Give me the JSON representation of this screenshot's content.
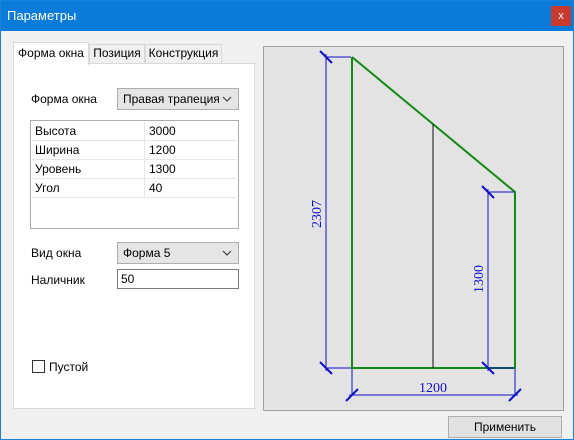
{
  "window": {
    "title": "Параметры",
    "close_label": "x"
  },
  "tabs": [
    {
      "label": "Форма окна",
      "active": true
    },
    {
      "label": "Позиция",
      "active": false
    },
    {
      "label": "Конструкция",
      "active": false
    }
  ],
  "form": {
    "shape_label": "Форма окна",
    "shape_value": "Правая трапеция",
    "params": [
      {
        "name": "Высота",
        "value": "3000"
      },
      {
        "name": "Ширина",
        "value": "1200"
      },
      {
        "name": "Уровень",
        "value": "1300"
      },
      {
        "name": "Угол",
        "value": "40"
      }
    ],
    "view_label": "Вид окна",
    "view_value": "Форма 5",
    "trim_label": "Наличник",
    "trim_value": "50",
    "empty_label": "Пустой",
    "empty_checked": false
  },
  "preview": {
    "dim_height": "2307",
    "dim_level": "1300",
    "dim_width": "1200",
    "outline_color": "#138a13",
    "dimension_color": "#1010c8"
  },
  "apply_button": "Применить"
}
